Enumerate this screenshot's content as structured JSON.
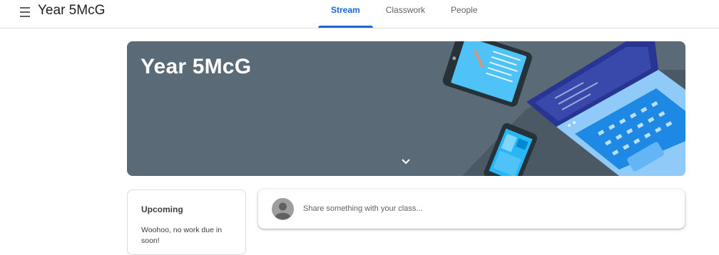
{
  "header": {
    "menu_icon": "hamburger-menu-icon",
    "class_title": "Year 5McG",
    "tabs": [
      {
        "label": "Stream",
        "active": true
      },
      {
        "label": "Classwork",
        "active": false
      },
      {
        "label": "People",
        "active": false
      }
    ]
  },
  "banner": {
    "title": "Year 5McG",
    "background_color": "#5a6a77",
    "expand_icon": "chevron-down-icon",
    "illustration": "devices-illustration"
  },
  "upcoming": {
    "title": "Upcoming",
    "message": "Woohoo, no work due in soon!"
  },
  "share": {
    "placeholder": "Share something with your class...",
    "avatar_icon": "default-avatar-icon"
  },
  "colors": {
    "accent": "#1967d2",
    "text": "#3c4043",
    "muted": "#5f6368"
  }
}
